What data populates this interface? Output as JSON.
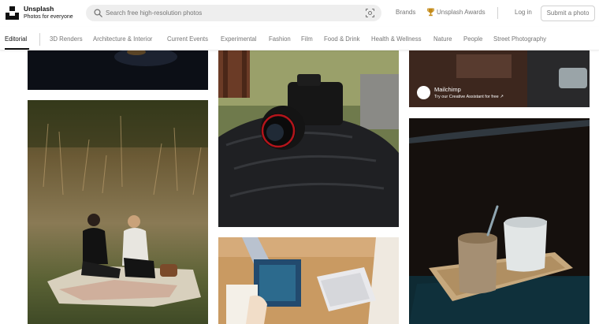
{
  "header": {
    "brand_name": "Unsplash",
    "brand_tagline": "Photos for everyone",
    "search_placeholder": "Search free high-resolution photos",
    "nav_brands": "Brands",
    "nav_awards": "Unsplash Awards",
    "nav_login": "Log in",
    "submit_label": "Submit a photo",
    "icons": [
      "unsplash-logo",
      "search-icon",
      "visual-search-icon",
      "trophy-icon"
    ]
  },
  "topics": {
    "active": "Editorial",
    "items": [
      "Editorial",
      "3D Renders",
      "Architecture & Interior",
      "Current Events",
      "Experimental",
      "Fashion",
      "Film",
      "Food & Drink",
      "Health & Wellness",
      "Nature",
      "People",
      "Street Photography"
    ]
  },
  "sponsor": {
    "name": "Mailchimp",
    "subtitle": "Try our Creative Assistant for free ↗"
  },
  "colors": {
    "text_primary": "#111111",
    "text_secondary": "#767676",
    "search_bg": "#eeeeee",
    "border": "#d1d1d1",
    "award_gold": "#c48a17"
  }
}
